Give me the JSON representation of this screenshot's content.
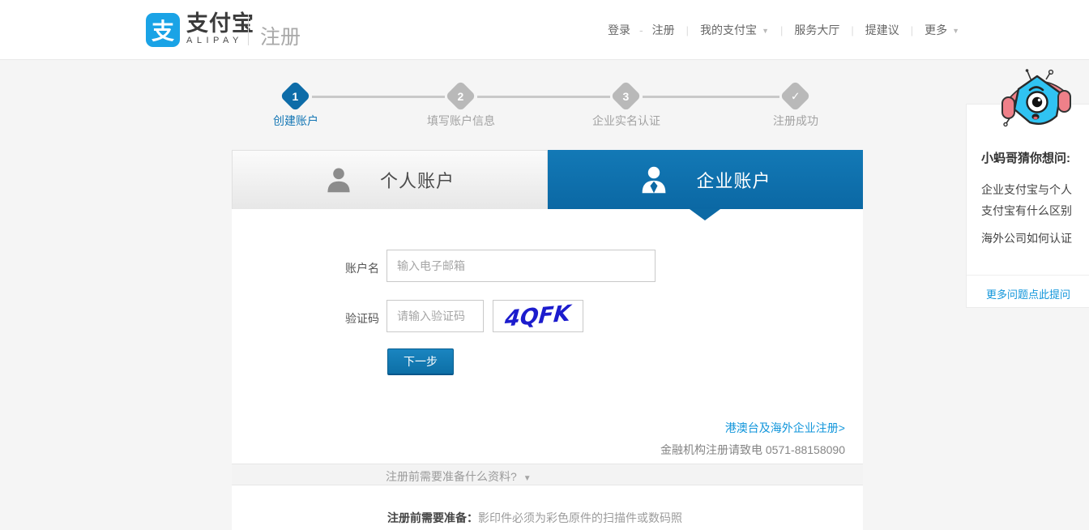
{
  "brand": {
    "logo_glyph": "支",
    "name": "支付宝",
    "name_latin": "ALIPAY",
    "page_title": "注册"
  },
  "nav": {
    "login": "登录",
    "register": "注册",
    "my_alipay": "我的支付宝",
    "service_hall": "服务大厅",
    "feedback": "提建议",
    "more": "更多",
    "sep_dash": "-",
    "sep_pipe": "|",
    "caret": "▼"
  },
  "steps": [
    {
      "num": "1",
      "label": "创建账户",
      "state": "active"
    },
    {
      "num": "2",
      "label": "填写账户信息",
      "state": "idle"
    },
    {
      "num": "3",
      "label": "企业实名认证",
      "state": "idle"
    },
    {
      "num": "✓",
      "label": "注册成功",
      "state": "idle"
    }
  ],
  "tabs": {
    "personal": "个人账户",
    "enterprise": "企业账户"
  },
  "form": {
    "account_label": "账户名",
    "account_placeholder": "输入电子邮箱",
    "captcha_label": "验证码",
    "captcha_placeholder": "请输入验证码",
    "captcha_code": "4QFK",
    "next_button": "下一步"
  },
  "links": {
    "overseas": "港澳台及海外企业注册>",
    "finance_hotline": "金融机构注册请致电 0571-88158090"
  },
  "accordion": {
    "question": "注册前需要准备什么资料?",
    "caret": "▼"
  },
  "prep_note": {
    "label": "注册前需要准备：",
    "text": "影印件必须为彩色原件的扫描件或数码照"
  },
  "assistant": {
    "title": "小蚂哥猜你想问:",
    "questions": [
      "企业支付宝与个人支付宝有什么区别",
      "海外公司如何认证"
    ],
    "more_link": "更多问题点此提问"
  },
  "colors": {
    "accent_blue": "#0d6ca8",
    "tab_blue": "#1379b6",
    "link_blue": "#1296db",
    "logo_blue": "#1aa3e6",
    "captcha_blue": "#1c1ccd"
  }
}
